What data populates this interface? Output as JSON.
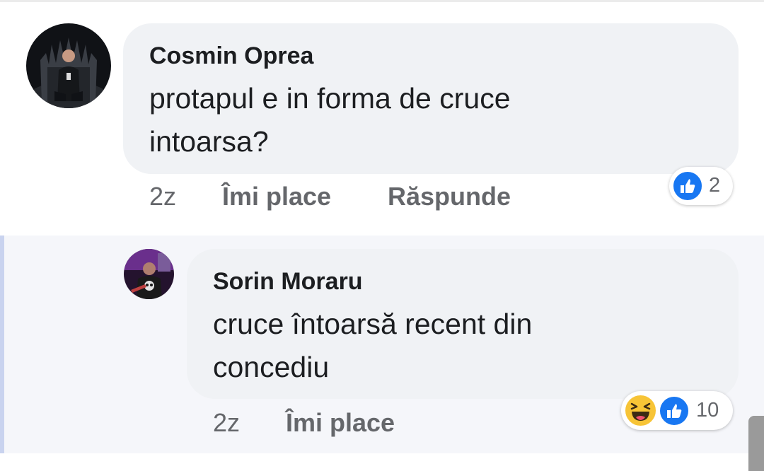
{
  "comments": [
    {
      "author": "Cosmin Oprea",
      "text_lines": [
        "protapul e in forma de cruce",
        "intoarsa?"
      ],
      "time": "2z",
      "like_label": "Îmi place",
      "reply_label": "Răspunde",
      "reactions": [
        "like-icon"
      ],
      "reaction_count": "2"
    },
    {
      "author": "Sorin Moraru",
      "text_lines": [
        "cruce întoarsă recent din",
        "concediu"
      ],
      "time": "2z",
      "like_label": "Îmi place",
      "reactions": [
        "haha-icon",
        "like-icon"
      ],
      "reaction_count": "10"
    }
  ],
  "colors": {
    "like_blue": "#1877f2",
    "haha_yellow": "#f7c436",
    "bubble_gray": "#f0f2f5",
    "meta_gray": "#65676b"
  }
}
